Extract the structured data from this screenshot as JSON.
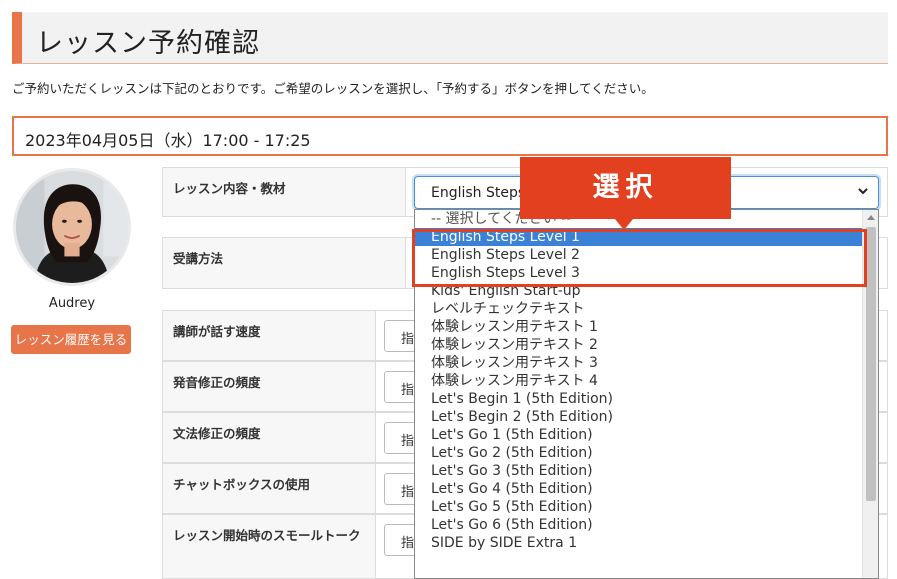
{
  "page": {
    "title": "レッスン予約確認",
    "intro": "ご予約いただくレッスンは下記のとおりです。ご希望のレッスンを選択し、「予約する」ボタンを押してください。",
    "datetime": "2023年04月05日（水）17:00 - 17:25"
  },
  "teacher": {
    "name": "Audrey",
    "history_button": "レッスン履歴を見る"
  },
  "form": {
    "lesson_label": "レッスン内容・教材",
    "lesson_selected": "English Steps Level 1",
    "method_label": "受講方法",
    "rows": [
      {
        "label": "講師が話す速度",
        "value": "指"
      },
      {
        "label": "発音修正の頻度",
        "value": "指"
      },
      {
        "label": "文法修正の頻度",
        "value": "指"
      },
      {
        "label": "チャットボックスの使用",
        "value": "指"
      },
      {
        "label": "レッスン開始時のスモールトーク",
        "value": "指"
      }
    ]
  },
  "dropdown": {
    "options": [
      "-- 選択してください --",
      "English Steps Level 1",
      "English Steps Level 2",
      "English Steps Level 3",
      "Kids' English Start-up",
      "レベルチェックテキスト",
      "体験レッスン用テキスト 1",
      "体験レッスン用テキスト 2",
      "体験レッスン用テキスト 3",
      "体験レッスン用テキスト 4",
      "Let's Begin 1 (5th Edition)",
      "Let's Begin 2 (5th Edition)",
      "Let's Go 1 (5th Edition)",
      "Let's Go 2 (5th Edition)",
      "Let's Go 3 (5th Edition)",
      "Let's Go 4 (5th Edition)",
      "Let's Go 5 (5th Edition)",
      "Let's Go 6 (5th Edition)",
      "SIDE by SIDE Extra 1"
    ],
    "selected_index": 1
  },
  "annotation": {
    "callout": "選択"
  },
  "colors": {
    "accent": "#e8744a",
    "annotation_red": "#e2401f",
    "selected_blue": "#3b82d6"
  }
}
